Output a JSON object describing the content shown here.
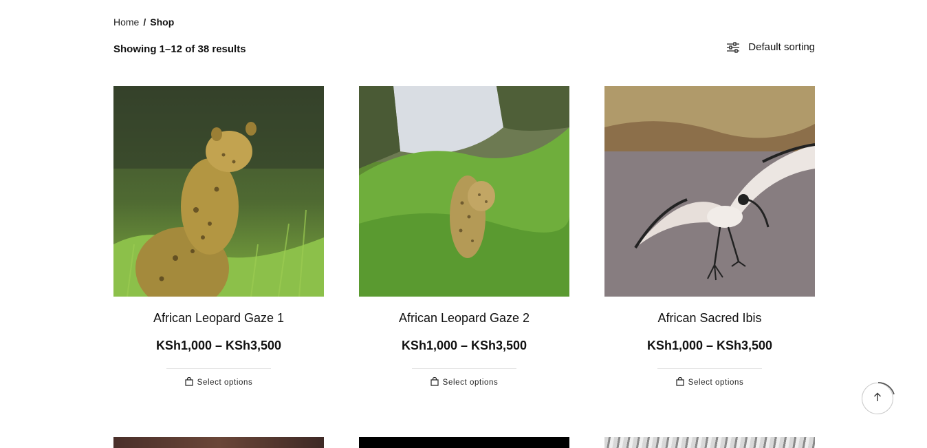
{
  "breadcrumb": {
    "home": "Home",
    "separator": "/",
    "current": "Shop"
  },
  "result_count": "Showing 1–12 of 38 results",
  "sorting": {
    "label": "Default sorting",
    "icon": "sliders-icon"
  },
  "products": [
    {
      "title": "African Leopard Gaze 1",
      "price": "KSh1,000 – KSh3,500",
      "action": "Select options"
    },
    {
      "title": "African Leopard Gaze 2",
      "price": "KSh1,000 – KSh3,500",
      "action": "Select options"
    },
    {
      "title": "African Sacred Ibis",
      "price": "KSh1,000 – KSh3,500",
      "action": "Select options"
    }
  ],
  "scroll_top": {
    "icon": "arrow-up-icon"
  }
}
